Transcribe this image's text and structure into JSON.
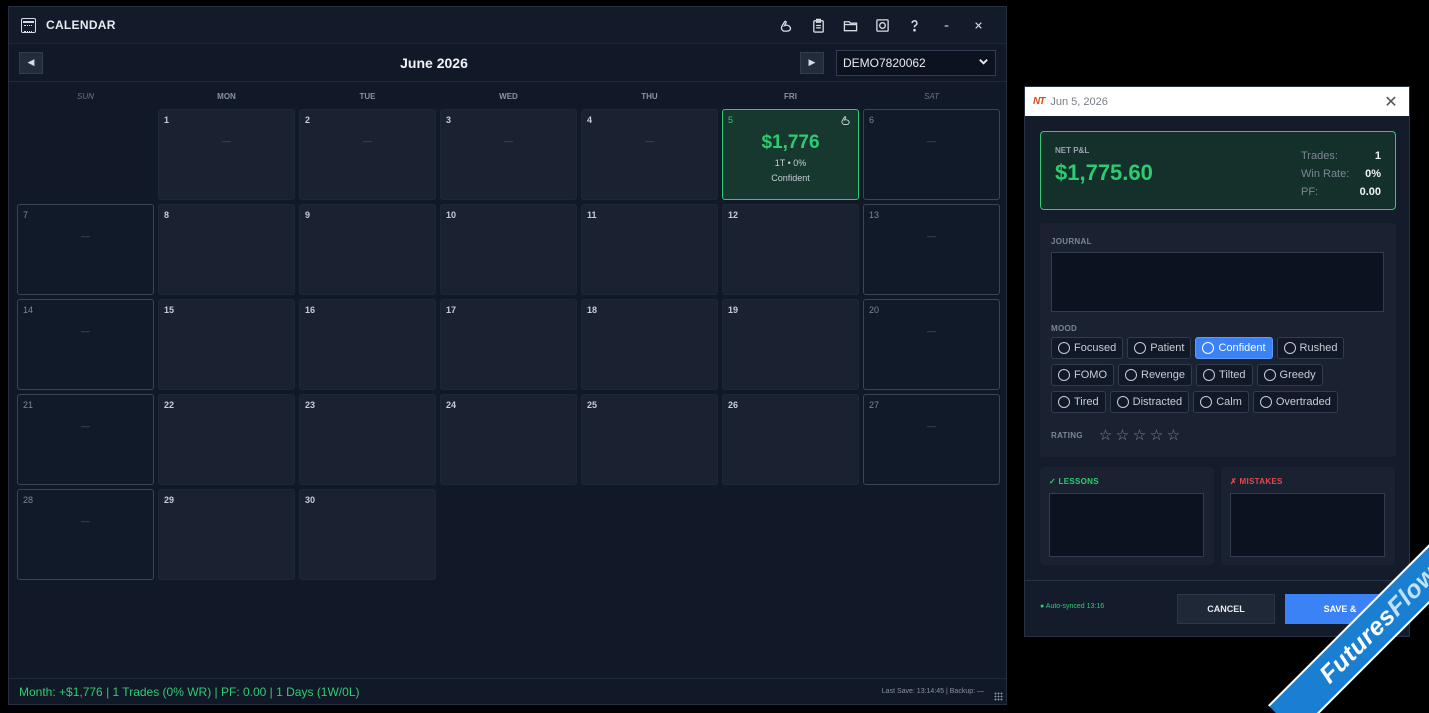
{
  "window": {
    "title": "CALENDAR"
  },
  "header": {
    "month_title": "June 2026",
    "prev_glyph": "◀",
    "next_glyph": "▶",
    "account": "DEMO7820062"
  },
  "weekdays": [
    "SUN",
    "MON",
    "TUE",
    "WED",
    "THU",
    "FRI",
    "SAT"
  ],
  "days": [
    {
      "n": "1",
      "dash": "—"
    },
    {
      "n": "2",
      "dash": "—"
    },
    {
      "n": "3",
      "dash": "—"
    },
    {
      "n": "4",
      "dash": "—"
    },
    {
      "n": "5",
      "pnl": "$1,776",
      "sub": "1T • 0%",
      "mood": "Confident"
    },
    {
      "n": "6",
      "dash": "—"
    },
    {
      "n": "7",
      "dash": "—"
    },
    {
      "n": "8"
    },
    {
      "n": "9"
    },
    {
      "n": "10"
    },
    {
      "n": "11"
    },
    {
      "n": "12"
    },
    {
      "n": "13",
      "dash": "—"
    },
    {
      "n": "14",
      "dash": "—"
    },
    {
      "n": "15"
    },
    {
      "n": "16"
    },
    {
      "n": "17"
    },
    {
      "n": "18"
    },
    {
      "n": "19"
    },
    {
      "n": "20",
      "dash": "—"
    },
    {
      "n": "21",
      "dash": "—"
    },
    {
      "n": "22"
    },
    {
      "n": "23"
    },
    {
      "n": "24"
    },
    {
      "n": "25"
    },
    {
      "n": "26"
    },
    {
      "n": "27",
      "dash": "—"
    },
    {
      "n": "28",
      "dash": "—"
    },
    {
      "n": "29"
    },
    {
      "n": "30"
    }
  ],
  "status": {
    "summary": "Month: +$1,776  |  1 Trades (0% WR)  |  PF: 0.00  |  1 Days (1W/0L)",
    "last_save": "Last Save: 13:14:45  |  Backup: —"
  },
  "dialog": {
    "logo": "NT",
    "title": "Jun 5, 2026",
    "close_glyph": "✕",
    "net_label": "NET P&L",
    "net_value": "$1,775.60",
    "trades_label": "Trades:",
    "trades_value": "1",
    "winrate_label": "Win Rate:",
    "winrate_value": "0%",
    "pf_label": "PF:",
    "pf_value": "0.00",
    "journal_label": "JOURNAL",
    "mood_label": "MOOD",
    "moods": [
      [
        "Focused",
        "Patient",
        "Confident",
        "Rushed"
      ],
      [
        "FOMO",
        "Revenge",
        "Tilted",
        "Greedy"
      ],
      [
        "Tired",
        "Distracted",
        "Calm",
        "Overtraded"
      ]
    ],
    "selected_mood": "Confident",
    "rating_label": "RATING",
    "rating_value": 0,
    "rating_max": 5,
    "star_glyph": "☆",
    "lessons_label": "✓ LESSONS",
    "mistakes_label": "✗ MISTAKES",
    "synced": "● Auto-synced 13:16",
    "cancel_label": "CANCEL",
    "save_label": "SAVE &"
  },
  "watermark": {
    "text_a": "Futures",
    "text_b": "Flow.io"
  },
  "colors": {
    "accent_green": "#2ecc71",
    "accent_blue": "#3b82f6",
    "loss_red": "#e5484d"
  }
}
